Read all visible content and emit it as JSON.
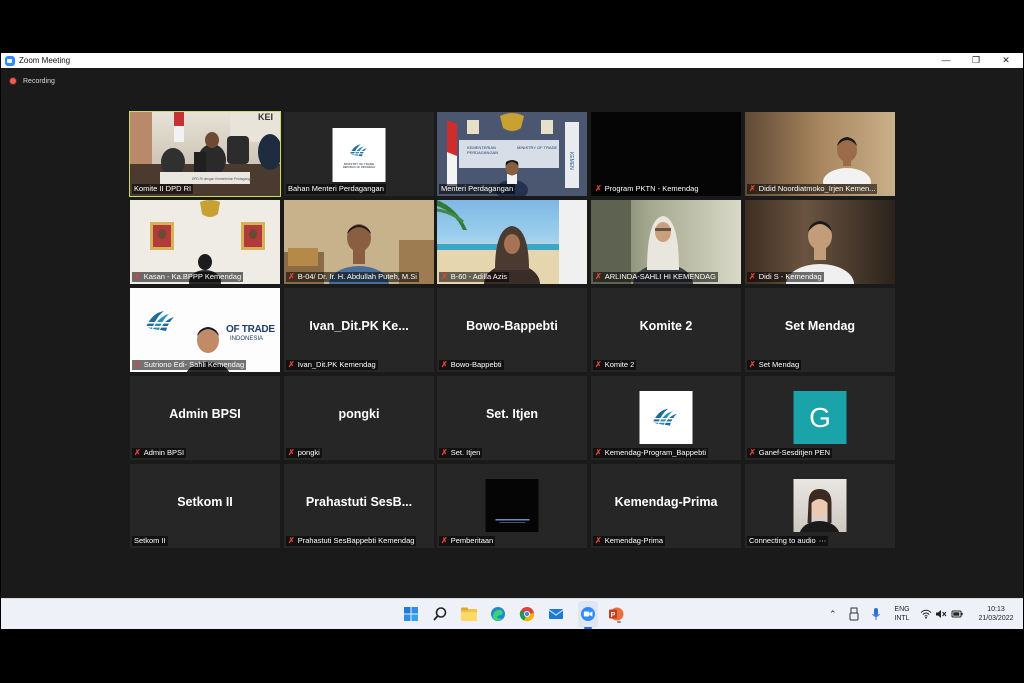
{
  "window": {
    "title": "Zoom Meeting",
    "minimize": "—",
    "restore": "❐",
    "close": "✕"
  },
  "recording": {
    "label": "Recording"
  },
  "participants": [
    {
      "name": "Komite II DPD RI",
      "muted": false,
      "video": true
    },
    {
      "name": "Bahan Menteri Perdagangan",
      "muted": false,
      "video": true
    },
    {
      "name": "Menteri Perdagangan",
      "muted": false,
      "video": true
    },
    {
      "name": "Program PKTN - Kemendag",
      "muted": true,
      "video": true
    },
    {
      "name": "Didid Noordiatmoko_Irjen Kemen...",
      "muted": true,
      "video": true
    },
    {
      "name": "Kasan - Ka.BPPP Kemendag",
      "muted": true,
      "video": true
    },
    {
      "name": "B-04/ Dr. Ir. H. Abdullah Puteh, M.Si",
      "muted": true,
      "video": true
    },
    {
      "name": "B-60 - Adilla Azis",
      "muted": true,
      "video": true
    },
    {
      "name": "ARLINDA-SAHLI HI KEMENDAG",
      "muted": true,
      "video": true
    },
    {
      "name": "Didi S - Kemendag",
      "muted": true,
      "video": true
    },
    {
      "name": "Sutriono Edi- Sahli Kemendag",
      "muted": true,
      "video": true
    },
    {
      "name": "Ivan_Dit.PK Kemendag",
      "display": "Ivan_Dit.PK  Ke...",
      "muted": true,
      "video": false
    },
    {
      "name": "Bowo-Bappebti",
      "display": "Bowo-Bappebti",
      "muted": true,
      "video": false
    },
    {
      "name": "Komite 2",
      "display": "Komite 2",
      "muted": true,
      "video": false
    },
    {
      "name": "Set Mendag",
      "display": "Set Mendag",
      "muted": true,
      "video": false
    },
    {
      "name": "Admin BPSI",
      "display": "Admin BPSI",
      "muted": true,
      "video": false
    },
    {
      "name": "pongki",
      "display": "pongki",
      "muted": true,
      "video": false
    },
    {
      "name": "Set. Itjen",
      "display": "Set. Itjen",
      "muted": true,
      "video": false
    },
    {
      "name": "Kemendag-Program_Bappebti",
      "muted": true,
      "video": false,
      "avatar": "logo"
    },
    {
      "name": "Ganef-Sesditjen PEN",
      "muted": true,
      "video": false,
      "avatar": "G"
    },
    {
      "name": "Setkom II",
      "display": "Setkom II",
      "muted": false,
      "video": false
    },
    {
      "name": "Prahastuti SesBappebti Kemendag",
      "display": "Prahastuti  SesB...",
      "muted": true,
      "video": false
    },
    {
      "name": "Pemberitaan",
      "muted": true,
      "video": false,
      "avatar": "dark"
    },
    {
      "name": "Kemendag-Prima",
      "display": "Kemendag-Prima",
      "muted": true,
      "video": false
    },
    {
      "name": "Connecting to audio",
      "muted": false,
      "video": false,
      "avatar": "photo"
    }
  ],
  "logo_text": {
    "ministry_small": "MINISTRY OF TRADE",
    "republic_small": "REPUBLIC OF INDONESIA",
    "banner_big": "OF TRADE",
    "banner_sub": "INDONESIA"
  },
  "taskbar": {
    "apps": [
      "windows-start",
      "search",
      "file-explorer",
      "edge",
      "chrome",
      "mail",
      "calendar",
      "zoom",
      "powerpoint"
    ],
    "lang_top": "ENG",
    "lang_bottom": "INTL",
    "time": "10:13",
    "date": "21/03/2022"
  },
  "colors": {
    "tile_bg": "#262626",
    "window_bg": "#1a1a1a",
    "active_speaker": "#c9e04a",
    "muted_red": "#e5403a",
    "avatar_teal": "#1aa3a8"
  }
}
